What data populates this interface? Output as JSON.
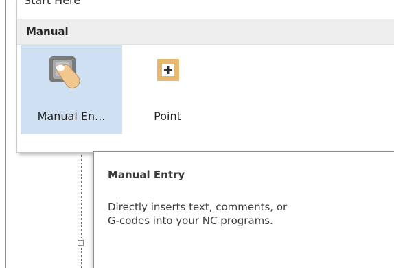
{
  "gallery": {
    "clipped_title": "Start Here",
    "group_label": "Manual",
    "tiles": [
      {
        "label": "Manual En...",
        "icon": "hand-touch-icon",
        "selected": true
      },
      {
        "label": "Point",
        "icon": "plus-box-icon",
        "selected": false
      }
    ]
  },
  "tooltip": {
    "title": "Manual Entry",
    "body_line1": "Directly inserts text, comments, or",
    "body_line2": "G-codes into your NC programs."
  },
  "colors": {
    "selected_tile": "#cfe0f2",
    "point_icon": "#e6b870",
    "group_header": "#eeeeee"
  }
}
